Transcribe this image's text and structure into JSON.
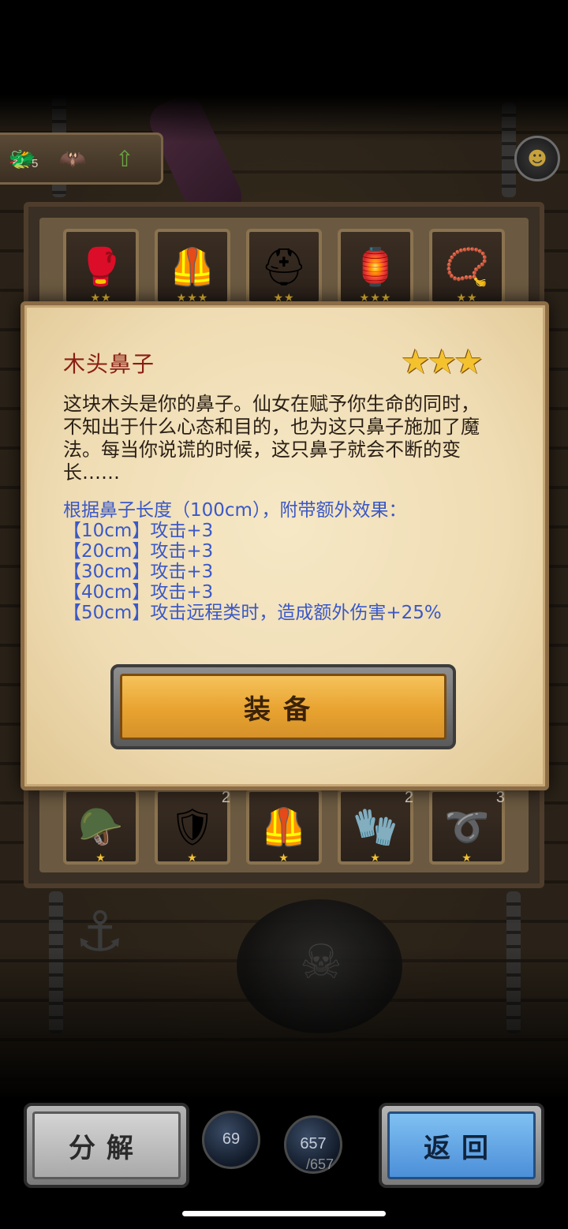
{
  "top_bar": {
    "stat_count": "5",
    "icons": [
      "monster-head-icon",
      "bat-wing-icon",
      "up-arrow-icon"
    ]
  },
  "inventory": {
    "top_row": [
      {
        "icon": "gauntlet-icon",
        "glyph": "🥊",
        "stars": "★★"
      },
      {
        "icon": "red-armor-icon",
        "glyph": "🦺",
        "stars": "★★★"
      },
      {
        "icon": "red-helmet-icon",
        "glyph": "⛑",
        "stars": "★★"
      },
      {
        "icon": "lantern-icon",
        "glyph": "🏮",
        "stars": "★★★"
      },
      {
        "icon": "amulet-icon",
        "glyph": "📿",
        "stars": "★★"
      }
    ],
    "bottom_row": [
      {
        "icon": "winged-helmet-icon",
        "glyph": "🪖",
        "stars": "★",
        "count": ""
      },
      {
        "icon": "iron-armor-icon",
        "glyph": "🛡",
        "stars": "★",
        "count": "2"
      },
      {
        "icon": "chestplate-icon",
        "glyph": "🦺",
        "stars": "★",
        "count": ""
      },
      {
        "icon": "iron-gauntlet-icon",
        "glyph": "🧤",
        "stars": "★",
        "count": "2"
      },
      {
        "icon": "belt-icon",
        "glyph": "➰",
        "stars": "★",
        "count": "3"
      }
    ]
  },
  "dialog": {
    "title": "木头鼻子",
    "stars": "★★★",
    "description": "这块木头是你的鼻子。仙女在赋予你生命的同时，不知出于什么心态和目的，也为这只鼻子施加了魔法。每当你说谎的时候，这只鼻子就会不断的变长……",
    "effect_header": "根据鼻子长度（100cm），附带额外效果：",
    "effects": [
      "【10cm】攻击+3",
      "【20cm】攻击+3",
      "【30cm】攻击+3",
      "【40cm】攻击+3",
      "【50cm】攻击远程类时，造成额外伤害+25%"
    ],
    "equip_label": "装备"
  },
  "bottom_bar": {
    "decompose_label": "分解",
    "back_label": "返回",
    "orb1_value": "69",
    "orb2_value": "657",
    "orb2_sub": "/657"
  }
}
